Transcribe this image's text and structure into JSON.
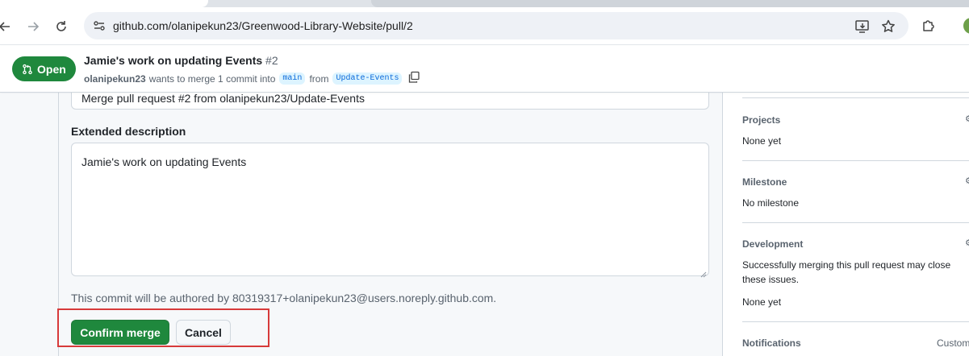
{
  "browser": {
    "url": "github.com/olanipekun23/Greenwood-Library-Website/pull/2"
  },
  "pr": {
    "state": "Open",
    "title": "Jamie's work on updating Events",
    "number": "#2",
    "author": "olanipekun23",
    "meta_text_1": "wants to merge 1 commit into",
    "base_branch": "main",
    "meta_text_2": "from",
    "head_branch": "Update-Events"
  },
  "merge_form": {
    "commit_title_value": "Merge pull request #2 from olanipekun23/Update-Events",
    "extended_label": "Extended description",
    "extended_value": "Jamie's work on updating Events",
    "author_note": "This commit will be authored by 80319317+olanipekun23@users.noreply.github.com.",
    "confirm_label": "Confirm merge",
    "cancel_label": "Cancel"
  },
  "sidebar": {
    "projects": {
      "heading": "Projects",
      "value": "None yet"
    },
    "milestone": {
      "heading": "Milestone",
      "value": "No milestone"
    },
    "development": {
      "heading": "Development",
      "description": "Successfully merging this pull request may close these issues.",
      "value": "None yet"
    },
    "notifications": {
      "heading": "Notifications",
      "action": "Customize"
    }
  },
  "colors": {
    "open_green": "#1f883d",
    "highlight_red": "#d73a3a",
    "branch_blue": "#0969da"
  }
}
